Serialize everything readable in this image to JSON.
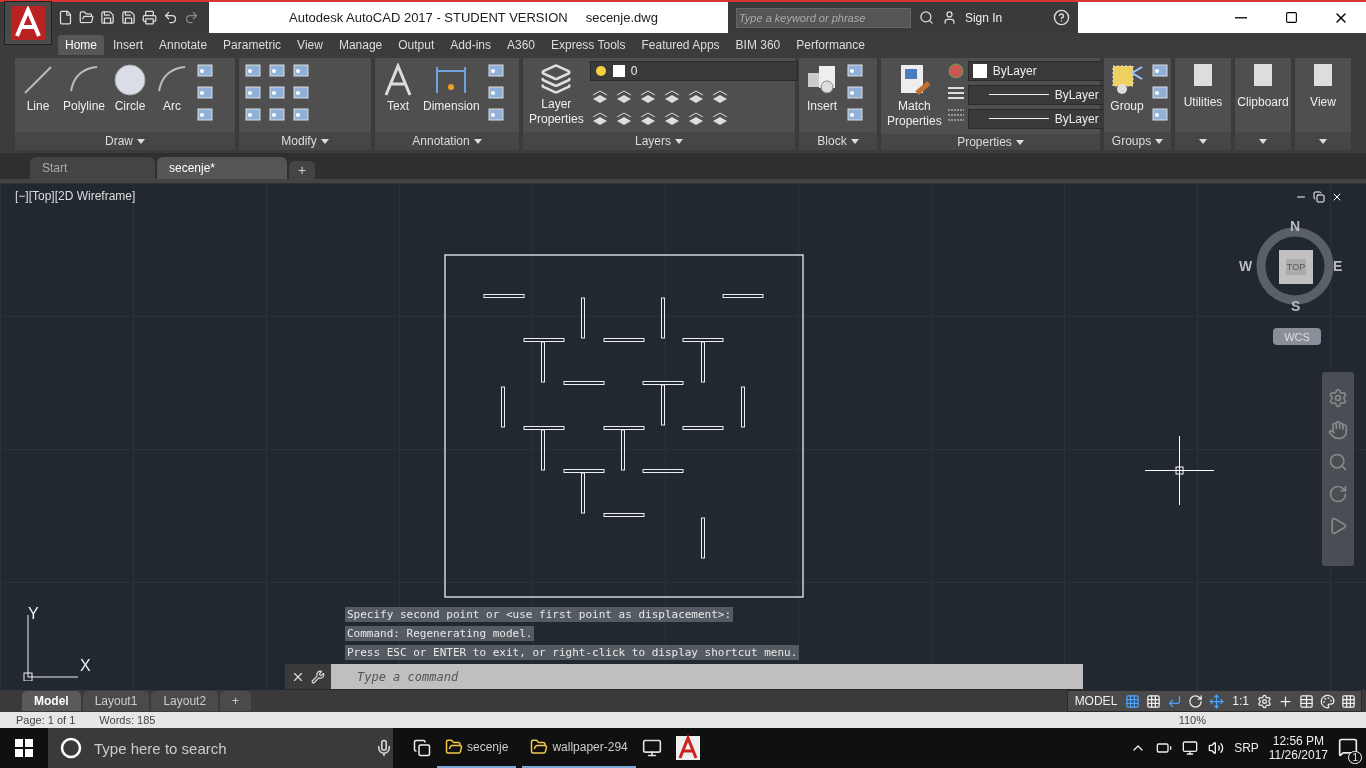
{
  "title_bar": {
    "title": "Autodesk AutoCAD 2017 - STUDENT VERSION",
    "file_name": "secenje.dwg",
    "search": {
      "placeholder": "Type a keyword or phrase"
    },
    "sign_in": "Sign In"
  },
  "ribbon_tabs": [
    {
      "label": "Home",
      "selected": true
    },
    {
      "label": "Insert",
      "selected": false
    },
    {
      "label": "Annotate",
      "selected": false
    },
    {
      "label": "Parametric",
      "selected": false
    },
    {
      "label": "View",
      "selected": false
    },
    {
      "label": "Manage",
      "selected": false
    },
    {
      "label": "Output",
      "selected": false
    },
    {
      "label": "Add-ins",
      "selected": false
    },
    {
      "label": "A360",
      "selected": false
    },
    {
      "label": "Express Tools",
      "selected": false
    },
    {
      "label": "Featured Apps",
      "selected": false
    },
    {
      "label": "BIM 360",
      "selected": false
    },
    {
      "label": "Performance",
      "selected": false
    }
  ],
  "ribbon_panels": [
    {
      "kind": "draw",
      "title": "Draw",
      "tools": [
        "Line",
        "Polyline",
        "Circle",
        "Arc"
      ]
    },
    {
      "kind": "modify",
      "title": "Modify"
    },
    {
      "kind": "annotation",
      "title": "Annotation",
      "tools": [
        "Text",
        "Dimension"
      ]
    },
    {
      "kind": "layers",
      "title": "Layers",
      "tools": [
        "Layer Properties"
      ],
      "layer": "0"
    },
    {
      "kind": "block",
      "title": "Block",
      "tools": [
        "Insert"
      ]
    },
    {
      "kind": "properties",
      "title": "Properties",
      "tools": [
        "Match Properties"
      ],
      "dropdowns": [
        "ByLayer",
        "ByLayer",
        "ByLayer"
      ]
    },
    {
      "kind": "groups",
      "title": "Groups",
      "tools": [
        "Group"
      ]
    },
    {
      "kind": "collapsed",
      "title": "Utilities"
    },
    {
      "kind": "collapsed",
      "title": "Clipboard"
    },
    {
      "kind": "collapsed",
      "title": "View"
    }
  ],
  "file_tabs": [
    {
      "label": "Start",
      "selected": false
    },
    {
      "label": "secenje*",
      "selected": true
    }
  ],
  "new_tab": "+",
  "viewport": {
    "label": "[−][Top][2D Wireframe]",
    "viewcube": {
      "north": "N",
      "south": "S",
      "east": "E",
      "west": "W",
      "face": "TOP",
      "ucs": "WCS"
    },
    "ucs_axes": {
      "x": "X",
      "y": "Y"
    }
  },
  "command_history": [
    "Specify second point or <use first point as displacement>:",
    "Command: Regenerating model.",
    "Press ESC or ENTER to exit, or right-click to display shortcut menu."
  ],
  "command_line": {
    "placeholder": "Type a command"
  },
  "layout_tabs": [
    {
      "label": "Model",
      "selected": true
    },
    {
      "label": "Layout1",
      "selected": false
    },
    {
      "label": "Layout2",
      "selected": false
    }
  ],
  "new_layout": "+",
  "status_bar": {
    "space": "MODEL",
    "scale": "1:1"
  },
  "background_window": {
    "page": "Page: 1 of 1",
    "words": "Words: 185",
    "zoom": "110%"
  },
  "taskbar": {
    "search_placeholder": "Type here to search",
    "items": [
      "secenje",
      "wallpaper-294"
    ],
    "language": "SRP",
    "time": "12:56 PM",
    "date": "11/26/2017",
    "notifications": "1"
  }
}
